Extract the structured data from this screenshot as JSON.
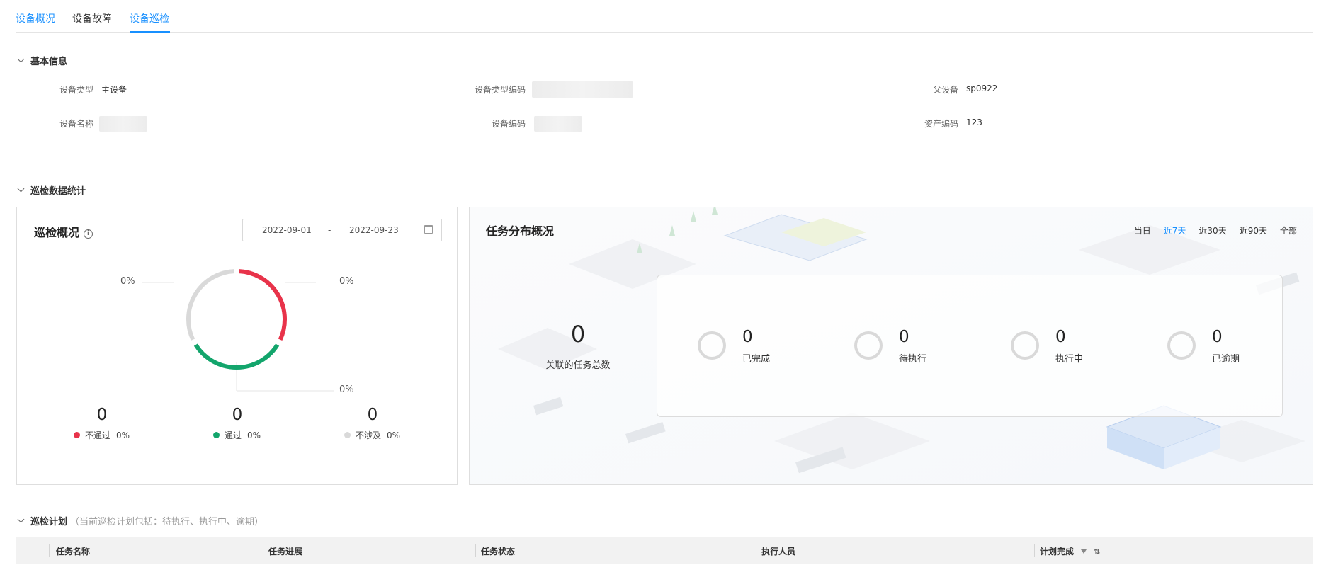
{
  "tabs": [
    {
      "label": "设备概况",
      "active": false
    },
    {
      "label": "设备故障",
      "active": false
    },
    {
      "label": "设备巡检",
      "active": true
    }
  ],
  "basic_info": {
    "title": "基本信息",
    "fields": [
      {
        "label": "设备类型",
        "value": "主设备"
      },
      {
        "label": "设备类型编码",
        "value": ""
      },
      {
        "label": "父设备",
        "value": "sp0922"
      },
      {
        "label": "设备名称",
        "value": ""
      },
      {
        "label": "设备编码",
        "value": ""
      },
      {
        "label": "资产编码",
        "value": "123"
      }
    ]
  },
  "stats_section": {
    "title": "巡检数据统计"
  },
  "overview": {
    "title": "巡检概况",
    "start_date": "2022-09-01",
    "date_sep": "-",
    "end_date": "2022-09-23",
    "pct_top_left": "0%",
    "pct_top_right": "0%",
    "pct_bottom_right": "0%",
    "items": [
      {
        "count": "0",
        "label": "不通过",
        "pct": "0%",
        "color": "#e8334a"
      },
      {
        "count": "0",
        "label": "通过",
        "pct": "0%",
        "color": "#13a56c"
      },
      {
        "count": "0",
        "label": "不涉及",
        "pct": "0%",
        "color": "#d9d9d9"
      }
    ]
  },
  "distribution": {
    "title": "任务分布概况",
    "ranges": [
      {
        "label": "当日",
        "active": false
      },
      {
        "label": "近7天",
        "active": true
      },
      {
        "label": "近30天",
        "active": false
      },
      {
        "label": "近90天",
        "active": false
      },
      {
        "label": "全部",
        "active": false
      }
    ],
    "total": "0",
    "total_label": "关联的任务总数",
    "states": [
      {
        "count": "0",
        "label": "已完成"
      },
      {
        "count": "0",
        "label": "待执行"
      },
      {
        "count": "0",
        "label": "执行中"
      },
      {
        "count": "0",
        "label": "已逾期"
      }
    ]
  },
  "plan": {
    "title": "巡检计划",
    "note": "（当前巡检计划包括：待执行、执行中、逾期）",
    "columns": [
      "任务名称",
      "任务进展",
      "任务状态",
      "执行人员",
      "计划完成"
    ]
  },
  "colors": {
    "accent": "#1890ff",
    "fail": "#e8334a",
    "pass": "#13a56c",
    "na": "#d9d9d9"
  }
}
